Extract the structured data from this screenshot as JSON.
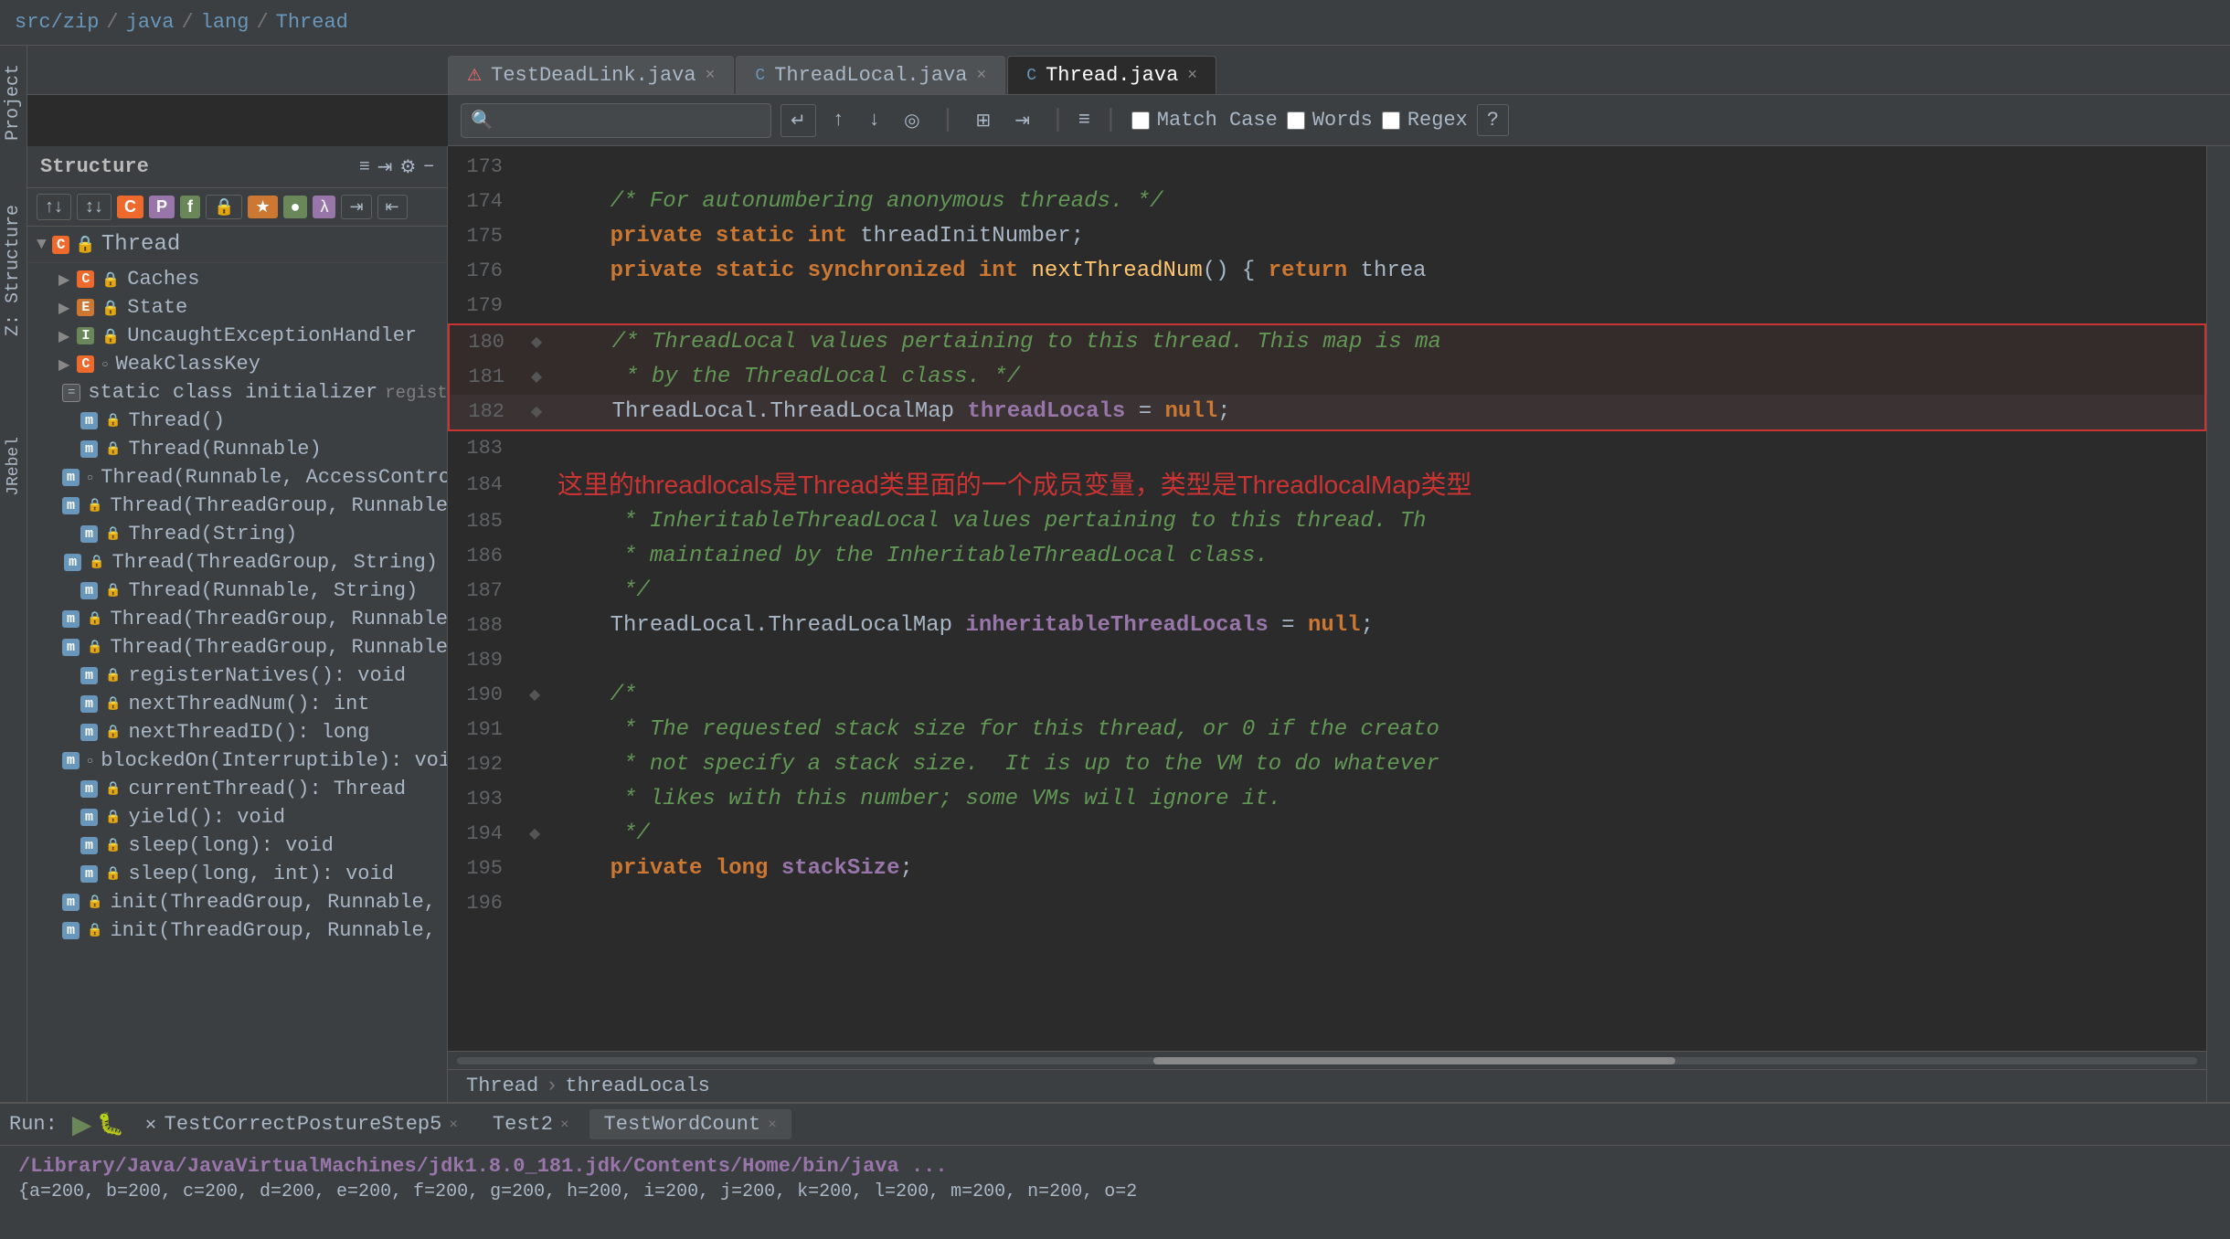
{
  "breadcrumb": {
    "parts": [
      "src/zip",
      "java",
      "lang",
      "Thread"
    ]
  },
  "tabs": [
    {
      "id": "tab-testdeadlink",
      "label": "TestDeadLink.java",
      "active": false,
      "error": true
    },
    {
      "id": "tab-threadlocal",
      "label": "ThreadLocal.java",
      "active": false,
      "error": false
    },
    {
      "id": "tab-thread",
      "label": "Thread.java",
      "active": true,
      "error": false
    }
  ],
  "search": {
    "placeholder": "",
    "match_case_label": "Match Case",
    "words_label": "Words",
    "regex_label": "Regex",
    "help_label": "?"
  },
  "sidebar": {
    "title": "Structure",
    "root": "Thread",
    "items": [
      {
        "indent": 1,
        "type": "C",
        "access": "lock",
        "label": "Caches",
        "expanded": false
      },
      {
        "indent": 1,
        "type": "E",
        "access": "lock",
        "label": "State",
        "expanded": false
      },
      {
        "indent": 1,
        "type": "I",
        "access": "lock",
        "label": "UncaughtExceptionHandler",
        "expanded": false
      },
      {
        "indent": 1,
        "type": "C",
        "access": "circle",
        "label": "WeakClassKey",
        "expanded": false
      },
      {
        "indent": 1,
        "type": "static",
        "access": "",
        "label": "static class initializer",
        "extra": "registerNatives();",
        "expanded": false
      },
      {
        "indent": 1,
        "type": "m",
        "access": "lock_green",
        "label": "Thread()",
        "expanded": false
      },
      {
        "indent": 1,
        "type": "m",
        "access": "lock_green",
        "label": "Thread(Runnable)",
        "expanded": false
      },
      {
        "indent": 1,
        "type": "m",
        "access": "circle",
        "label": "Thread(Runnable, AccessControlContext)",
        "expanded": false
      },
      {
        "indent": 1,
        "type": "m",
        "access": "lock_green",
        "label": "Thread(ThreadGroup, Runnable)",
        "expanded": false
      },
      {
        "indent": 1,
        "type": "m",
        "access": "lock_green",
        "label": "Thread(String)",
        "expanded": false
      },
      {
        "indent": 1,
        "type": "m",
        "access": "lock_green",
        "label": "Thread(ThreadGroup, String)",
        "expanded": false
      },
      {
        "indent": 1,
        "type": "m",
        "access": "lock_green",
        "label": "Thread(Runnable, String)",
        "expanded": false
      },
      {
        "indent": 1,
        "type": "m",
        "access": "lock_green",
        "label": "Thread(ThreadGroup, Runnable, String)",
        "expanded": false
      },
      {
        "indent": 1,
        "type": "m",
        "access": "lock_green",
        "label": "Thread(ThreadGroup, Runnable, String, lon",
        "expanded": false
      },
      {
        "indent": 1,
        "type": "m",
        "access": "lock",
        "label": "registerNatives(): void",
        "expanded": false
      },
      {
        "indent": 1,
        "type": "m",
        "access": "lock",
        "label": "nextThreadNum(): int",
        "expanded": false
      },
      {
        "indent": 1,
        "type": "m",
        "access": "lock",
        "label": "nextThreadID(): long",
        "expanded": false
      },
      {
        "indent": 1,
        "type": "m",
        "access": "circle",
        "label": "blockedOn(Interruptible): void",
        "expanded": false
      },
      {
        "indent": 1,
        "type": "m",
        "access": "lock_green",
        "label": "currentThread(): Thread",
        "expanded": false
      },
      {
        "indent": 1,
        "type": "m",
        "access": "lock_green",
        "label": "yield(): void",
        "expanded": false
      },
      {
        "indent": 1,
        "type": "m",
        "access": "lock_green",
        "label": "sleep(long): void",
        "expanded": false
      },
      {
        "indent": 1,
        "type": "m",
        "access": "lock_green",
        "label": "sleep(long, int): void",
        "expanded": false
      },
      {
        "indent": 1,
        "type": "m",
        "access": "lock_green",
        "label": "init(ThreadGroup, Runnable, String, long):",
        "expanded": false
      },
      {
        "indent": 1,
        "type": "m",
        "access": "lock_green",
        "label": "init(ThreadGroup, Runnable, String, long, A",
        "expanded": false
      }
    ]
  },
  "code": {
    "lines": [
      {
        "num": "173",
        "gutter": "",
        "content": "",
        "type": "empty"
      },
      {
        "num": "174",
        "gutter": "",
        "content": "    /* For autonumbering anonymous threads. */",
        "type": "comment"
      },
      {
        "num": "175",
        "gutter": "",
        "content": "    private static int threadInitNumber;",
        "type": "code"
      },
      {
        "num": "176",
        "gutter": "",
        "content": "    private static synchronized int nextThreadNum() { return threa",
        "type": "code"
      },
      {
        "num": "179",
        "gutter": "",
        "content": "",
        "type": "empty"
      },
      {
        "num": "180",
        "gutter": "◆",
        "content": "    /* ThreadLocal values pertaining to this thread. This map is ma",
        "type": "comment_highlight"
      },
      {
        "num": "181",
        "gutter": "◆",
        "content": "     * by the ThreadLocal class. */",
        "type": "comment_highlight"
      },
      {
        "num": "182",
        "gutter": "◆",
        "content": "    ThreadLocal.ThreadLocalMap threadLocals = null;",
        "type": "code_highlight"
      },
      {
        "num": "183",
        "gutter": "",
        "content": "",
        "type": "empty"
      },
      {
        "num": "184",
        "gutter": "",
        "content": "这里的threadlocals是Thread类里面的一个成员变量，类型是ThreadlocalMap类型",
        "type": "annotation"
      },
      {
        "num": "185",
        "gutter": "",
        "content": "     * InheritableThreadLocal values pertaining to this thread. Th",
        "type": "comment"
      },
      {
        "num": "186",
        "gutter": "",
        "content": "     * maintained by the InheritableThreadLocal class.",
        "type": "comment"
      },
      {
        "num": "187",
        "gutter": "",
        "content": "     */",
        "type": "comment"
      },
      {
        "num": "188",
        "gutter": "",
        "content": "    ThreadLocal.ThreadLocalMap inheritableThreadLocals = null;",
        "type": "code"
      },
      {
        "num": "189",
        "gutter": "",
        "content": "",
        "type": "empty"
      },
      {
        "num": "190",
        "gutter": "◆",
        "content": "    /*",
        "type": "comment"
      },
      {
        "num": "191",
        "gutter": "",
        "content": "     * The requested stack size for this thread, or 0 if the creato",
        "type": "comment"
      },
      {
        "num": "192",
        "gutter": "",
        "content": "     * not specify a stack size.  It is up to the VM to do whatever",
        "type": "comment"
      },
      {
        "num": "193",
        "gutter": "",
        "content": "     * likes with this number; some VMs will ignore it.",
        "type": "comment"
      },
      {
        "num": "194",
        "gutter": "◆",
        "content": "     */",
        "type": "comment"
      },
      {
        "num": "195",
        "gutter": "",
        "content": "    private long stackSize;",
        "type": "code"
      },
      {
        "num": "196",
        "gutter": "",
        "content": "",
        "type": "empty"
      }
    ],
    "breadcrumb": "Thread > threadLocals"
  },
  "bottom": {
    "run_label": "Run:",
    "tabs": [
      {
        "label": "TestCorrectPostureStep5",
        "active": false
      },
      {
        "label": "Test2",
        "active": false
      },
      {
        "label": "TestWordCount",
        "active": true
      }
    ],
    "path": "/Library/Java/JavaVirtualMachines/jdk1.8.0_181.jdk/Contents/Home/bin/java ...",
    "args": "{a=200, b=200, c=200, d=200, e=200, f=200, g=200, h=200, i=200, j=200, k=200, l=200, m=200, n=200, o=2"
  },
  "icons": {
    "search": "🔍",
    "close": "×",
    "arrow_up": "↑",
    "arrow_down": "↓",
    "target": "◎",
    "expand": "⊞",
    "filter": "≡",
    "gear": "⚙",
    "minus": "−",
    "sort_asc": "↕",
    "indent": "⇥",
    "tree_collapse": "▼",
    "tree_expand": "▶",
    "run": "▶",
    "debug": "🐛"
  }
}
